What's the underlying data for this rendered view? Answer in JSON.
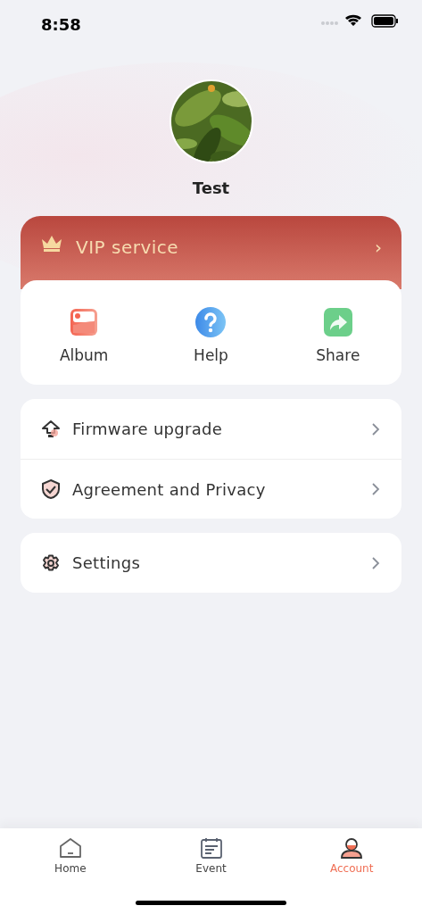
{
  "status_bar": {
    "time": "8:58"
  },
  "profile": {
    "name": "Test"
  },
  "vip": {
    "label": "VIP service",
    "chevron": "›"
  },
  "shortcuts": [
    {
      "kind": "album",
      "label": "Album"
    },
    {
      "kind": "help",
      "label": "Help"
    },
    {
      "kind": "share",
      "label": "Share"
    }
  ],
  "menu_groups": [
    [
      {
        "kind": "firmware",
        "label": "Firmware upgrade"
      },
      {
        "kind": "privacy",
        "label": "Agreement and Privacy"
      }
    ],
    [
      {
        "kind": "settings",
        "label": "Settings"
      }
    ]
  ],
  "tabs": [
    {
      "kind": "home",
      "label": "Home",
      "selected": false
    },
    {
      "kind": "event",
      "label": "Event",
      "selected": false
    },
    {
      "kind": "account",
      "label": "Account",
      "selected": true
    }
  ]
}
